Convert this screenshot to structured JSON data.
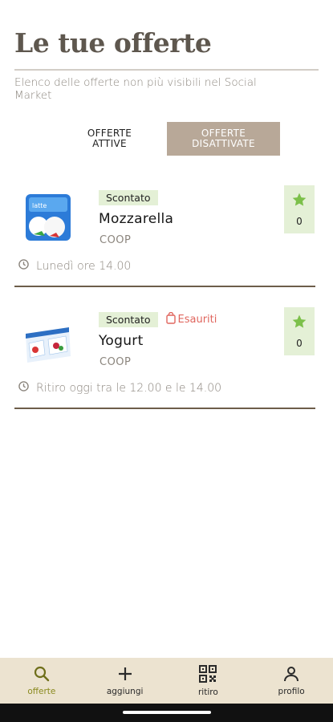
{
  "header": {
    "title": "Le tue offerte",
    "subtitle": "Elenco delle offerte non più visibili nel Social Market"
  },
  "tabs": [
    {
      "label": "OFFERTE\nATTIVE",
      "selected": false
    },
    {
      "label": "OFFERTE\nDISATTIVATE",
      "selected": true
    }
  ],
  "offers": [
    {
      "badge": "Scontato",
      "status": "",
      "name": "Mozzarella",
      "store": "COOP",
      "time": "Lunedì ore 14.00",
      "favorites": "0"
    },
    {
      "badge": "Scontato",
      "status": "Esauriti",
      "name": "Yogurt",
      "store": "COOP",
      "time": "Ritiro oggi tra le 12.00 e le 14.00",
      "favorites": "0"
    }
  ],
  "nav": [
    {
      "label": "offerte",
      "icon": "search-icon",
      "active": true
    },
    {
      "label": "aggiungi",
      "icon": "plus-icon",
      "active": false
    },
    {
      "label": "ritiro",
      "icon": "qr-code-icon",
      "active": false
    },
    {
      "label": "profilo",
      "icon": "user-icon",
      "active": false
    }
  ],
  "colors": {
    "accent_green": "#e4f0d6",
    "star_green": "#7cc04a",
    "selected_tab": "#b8a898",
    "nav_background": "#ece3d0",
    "sold_out": "#e0665e"
  }
}
